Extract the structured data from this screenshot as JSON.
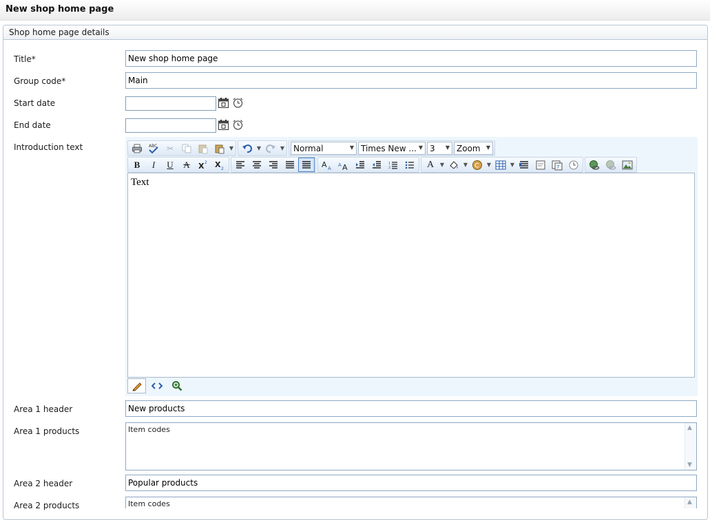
{
  "page": {
    "title": "New shop home page"
  },
  "panel": {
    "header": "Shop home page details"
  },
  "fields": {
    "title": {
      "label": "Title*",
      "value": "New shop home page"
    },
    "group_code": {
      "label": "Group code*",
      "value": "Main"
    },
    "start_date": {
      "label": "Start date",
      "value": ""
    },
    "end_date": {
      "label": "End date",
      "value": ""
    },
    "intro": {
      "label": "Introduction text"
    },
    "area1_header": {
      "label": "Area 1 header",
      "value": "New products"
    },
    "area1_products": {
      "label": "Area 1 products",
      "value": "Item codes"
    },
    "area2_header": {
      "label": "Area 2 header",
      "value": "Popular products"
    },
    "area2_products": {
      "label": "Area 2 products",
      "value": "Item codes"
    }
  },
  "editor": {
    "format": "Normal",
    "font": "Times New ...",
    "size": "3",
    "zoom": "Zoom",
    "content": "Text",
    "buttons": {
      "bold": "B",
      "italic": "I",
      "underline": "U",
      "strike": "A"
    },
    "icons": [
      "print-icon",
      "spellcheck-icon",
      "cut-icon",
      "copy-icon",
      "paste-icon",
      "paste-special-icon",
      "undo-icon",
      "redo-icon",
      "align-left-icon",
      "align-center-icon",
      "align-right-icon",
      "justify-icon",
      "subscript-icon",
      "superscript-icon",
      "indent-icon",
      "outdent-icon",
      "numbered-list-icon",
      "bullet-list-icon",
      "font-color-icon",
      "highlight-icon",
      "symbol-icon",
      "table-icon",
      "hyperlink-icon",
      "unlink-icon",
      "image-icon",
      "design-mode-icon",
      "html-mode-icon",
      "preview-icon"
    ]
  }
}
